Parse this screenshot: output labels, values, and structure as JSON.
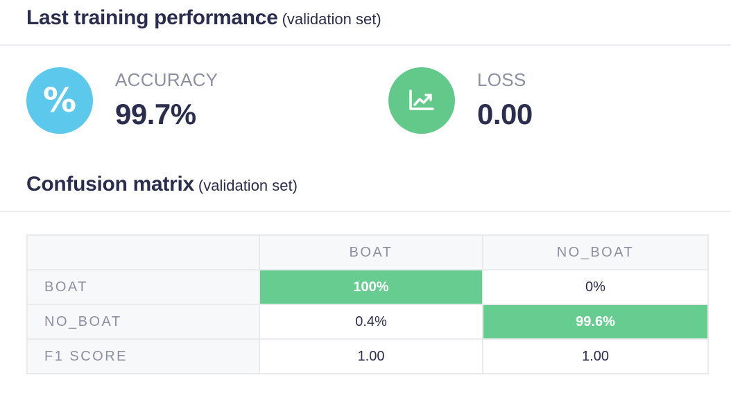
{
  "performance": {
    "title": "Last training performance",
    "subtitle": "(validation set)",
    "accuracy": {
      "label": "ACCURACY",
      "value": "99.7%",
      "icon": "percent-icon",
      "color": "#5bc8ec"
    },
    "loss": {
      "label": "LOSS",
      "value": "0.00",
      "icon": "trending-chart-icon",
      "color": "#63c98b"
    }
  },
  "confusion": {
    "title": "Confusion matrix",
    "subtitle": "(validation set)",
    "columns": [
      "BOAT",
      "NO_BOAT"
    ],
    "rows": [
      {
        "label": "BOAT",
        "cells": [
          "100%",
          "0%"
        ]
      },
      {
        "label": "NO_BOAT",
        "cells": [
          "0.4%",
          "99.6%"
        ]
      },
      {
        "label": "F1 SCORE",
        "cells": [
          "1.00",
          "1.00"
        ]
      }
    ],
    "highlight_color": "#66cc8f"
  }
}
